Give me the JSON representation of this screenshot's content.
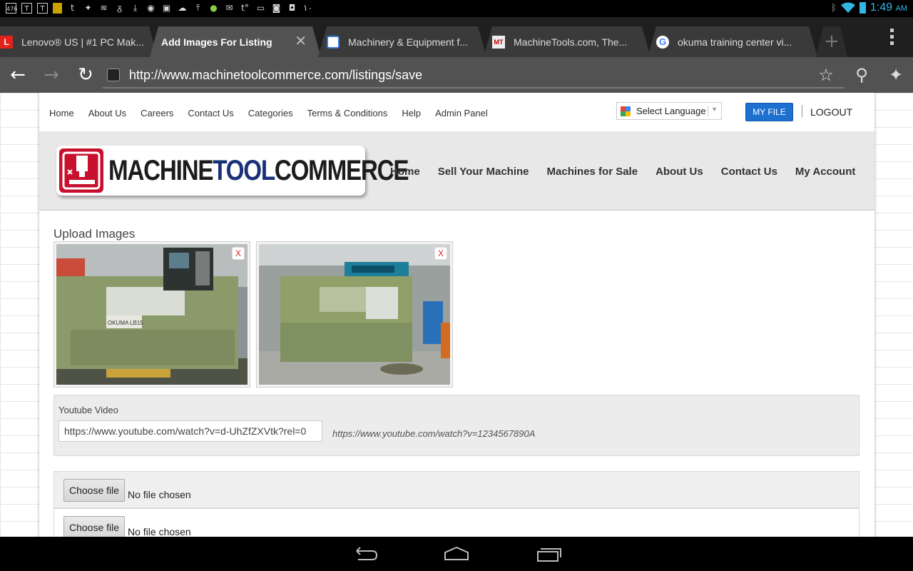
{
  "status_bar": {
    "time": "1:49",
    "ampm": "AM",
    "notification_icons": [
      "app-476-icon",
      "t-icon",
      "t-icon",
      "file-icon",
      "tumblr-icon",
      "twitter-icon",
      "feather-icon",
      "feather-icon",
      "download-icon",
      "clock-icon",
      "image-icon",
      "cloud-icon",
      "upload-icon",
      "apple-icon",
      "mail-icon",
      "t-icon",
      "tv-icon",
      "g-icon",
      "bag-icon",
      "arabic-10-icon"
    ]
  },
  "tabs": [
    {
      "title": "Lenovo® US | #1 PC Mak...",
      "icon": "lenovo-icon",
      "active": false
    },
    {
      "title": "Add Images For Listing",
      "icon": "",
      "active": true
    },
    {
      "title": "Machinery & Equipment f...",
      "icon": "gear-site-icon",
      "active": false
    },
    {
      "title": "MachineTools.com, The...",
      "icon": "mt-icon",
      "active": false
    },
    {
      "title": "okuma training center vi...",
      "icon": "google-icon",
      "active": false
    }
  ],
  "omnibox": {
    "url": "http://www.machinetoolcommerce.com/listings/save"
  },
  "topnav": {
    "links": [
      "Home",
      "About Us",
      "Careers",
      "Contact Us",
      "Categories",
      "Terms & Conditions",
      "Help",
      "Admin Panel"
    ],
    "language_label": "Select Language",
    "my_file": "MY FILE",
    "logout": "LOGOUT"
  },
  "header": {
    "logo_part1": "MACHINE",
    "logo_part2": "TOOL",
    "logo_part3": "COMMERCE",
    "nav": [
      "Home",
      "Sell Your Machine",
      "Machines for Sale",
      "About Us",
      "Contact Us",
      "My Account"
    ]
  },
  "upload": {
    "title": "Upload Images",
    "remove_label": "X",
    "images": [
      "uploaded machine photo 1",
      "uploaded machine photo 2"
    ],
    "plate_text": "OKUMA LB15"
  },
  "youtube": {
    "label": "Youtube Video",
    "value": "https://www.youtube.com/watch?v=d-UhZfZXVtk?rel=0",
    "hint": "https://www.youtube.com/watch?v=1234567890A"
  },
  "file_inputs": [
    {
      "button": "Choose file",
      "status": "No file chosen"
    },
    {
      "button": "Choose file",
      "status": "No file chosen"
    }
  ],
  "colors": {
    "brand_red": "#c8102e",
    "brand_blue": "#1a3178",
    "button_blue": "#1d6fd0",
    "clock_blue": "#33b5e5"
  }
}
